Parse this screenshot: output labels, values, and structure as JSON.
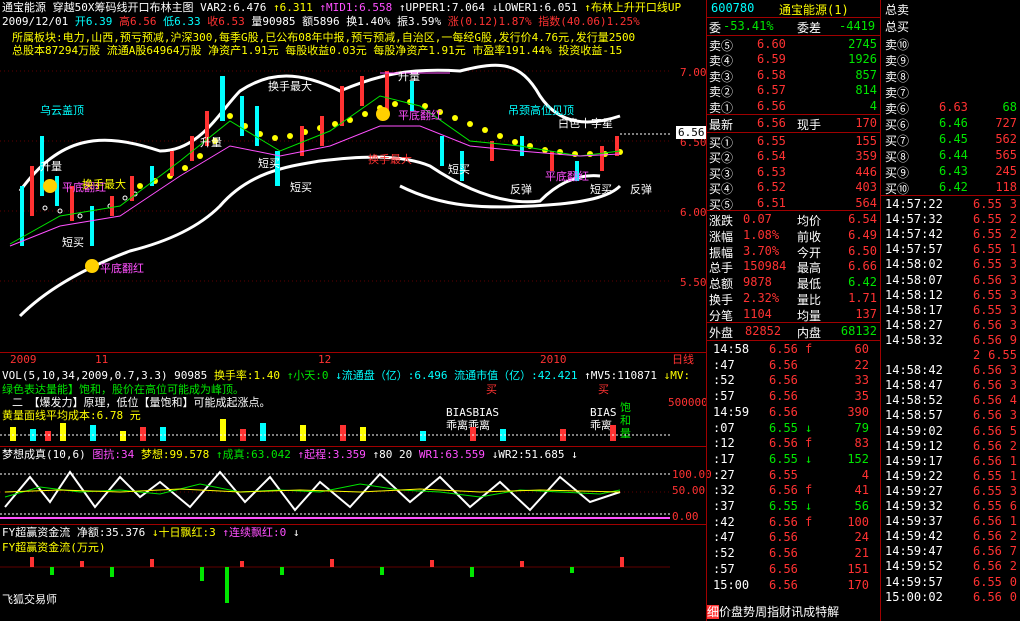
{
  "chart_header": {
    "stock": "通宝能源",
    "indicator": "穿越50X筹码线开口布林主图",
    "var2": "VAR2:6.476",
    "v6": "↑6.311",
    "mid1": "↑MID1:6.558",
    "upper1": "↑UPPER1:7.064",
    "lower1": "↓LOWER1:6.051",
    "boll": "↑布林上升开口线UP",
    "date": "2009/12/01",
    "open": "开6.39",
    "high": "高6.56",
    "low": "低6.33",
    "close": "收6.53",
    "vol": "量90985",
    "amt": "额5896",
    "turn": "换1.40%",
    "amp": "振3.59%",
    "chg": "涨(0.12)1.87%",
    "idx": "指数(40.06)1.25%"
  },
  "info_lines": [
    "所属板块:电力,山西,预亏预减,沪深300,每季G股,已公布08年中报,预亏预减,自治区,一每经G股,发行价4.76元,发行量2500",
    "总股本87294万股   流通A股64964万股   净资产1.91元    每股收益0.03元  每股净资产1.91元    市盈率191.44%   投资收益-15"
  ],
  "price_axis": [
    "7.00",
    "6.50",
    "6.00",
    "5.50"
  ],
  "current_price_tag": "6.56",
  "chart_labels": {
    "wuyun": "乌云盖顶",
    "diaojing": "吊颈高位见顶",
    "huanshou": "换手最大",
    "huanshou2": "换手最大",
    "shengliang": "升量",
    "shengliang2": "升量",
    "shengliang3": "升量",
    "duanmai": "短买",
    "duanmai2": "短买",
    "duanmai3": "短买",
    "duanmai4": "短买",
    "duanmai5": "短买",
    "fantan": "反弹",
    "fantan2": "反弹",
    "baise": "白色十字星",
    "pingdi": "平底翻红",
    "pingdi2": "平底翻红",
    "pingdi3": "平底翻红",
    "pingdi4": "平底翻红",
    "huanshou3": "换手最大"
  },
  "time_axis": {
    "a": "2009",
    "b": "11",
    "c": "12",
    "d": "2010",
    "right": "日线"
  },
  "vol_header": {
    "line1_a": "VOL(5,10,34,2009,0.7,3.3) 90985",
    "line1_b": "换手率:1.40",
    "line1_c": "↑小天:0",
    "line1_d": "↓流通盘（亿）:6.496",
    "line1_e": "流通市值（亿）:42.421",
    "line1_f": "↑MV5:110871",
    "line1_g": "↓MV:",
    "line2": "绿色表达量能】饱和，股价在高位可能成为峰顶。",
    "line3": "二　【爆发力】原理，低位【量饱和】可能成起涨点。",
    "line4": "黄量面线平均成本:6.78 元",
    "max": "500000",
    "bias1": "BIASBIAS",
    "bias2": "乖离乖离",
    "bias3": "BIAS",
    "bias4": "乖离",
    "buy1": "买",
    "buy2": "买",
    "hb": "饱和量"
  },
  "dream_header": {
    "a": "梦想成真(10,6)",
    "b": "图抗:34",
    "c": "梦想:99.578",
    "d": "↑成真:63.042",
    "e": "↑起程:3.359",
    "f": "↑80",
    "g": "20",
    "h": "WR1:63.559",
    "i": "↓WR2:51.685",
    "j": "↓",
    "axis": [
      "100.00",
      "50.00",
      "0.00"
    ]
  },
  "fund_header": {
    "a": "FY超赢资金流",
    "b": "净额:35.376",
    "c": "↓十日飘红:3",
    "d": "↑连续飘红:0",
    "e": "↓",
    "sub": "FY超赢资金流(万元)",
    "footer": "飞狐交易师"
  },
  "quote": {
    "code": "600780",
    "name": "通宝能源(1)",
    "weibi_label": "委",
    "weibi_val": "-53.41%",
    "weicha_label": "委差",
    "weicha_val": "-4419",
    "asks": [
      {
        "label": "卖⑤",
        "price": "6.60",
        "vol": "2745"
      },
      {
        "label": "卖④",
        "price": "6.59",
        "vol": "1926"
      },
      {
        "label": "卖③",
        "price": "6.58",
        "vol": "857"
      },
      {
        "label": "卖②",
        "price": "6.57",
        "vol": "814"
      },
      {
        "label": "卖①",
        "price": "6.56",
        "vol": "4"
      }
    ],
    "last_label": "最新",
    "last_price": "6.56",
    "xianshou_label": "现手",
    "xianshou_val": "170",
    "bids": [
      {
        "label": "买①",
        "price": "6.55",
        "vol": "155"
      },
      {
        "label": "买②",
        "price": "6.54",
        "vol": "359"
      },
      {
        "label": "买③",
        "price": "6.53",
        "vol": "446"
      },
      {
        "label": "买④",
        "price": "6.52",
        "vol": "403"
      },
      {
        "label": "买⑤",
        "price": "6.51",
        "vol": "564"
      }
    ],
    "stats": [
      {
        "l1": "涨跌",
        "v1": "0.07",
        "l2": "均价",
        "v2": "6.54"
      },
      {
        "l1": "涨幅",
        "v1": "1.08%",
        "l2": "前收",
        "v2": "6.49"
      },
      {
        "l1": "振幅",
        "v1": "3.70%",
        "l2": "今开",
        "v2": "6.50"
      },
      {
        "l1": "总手",
        "v1": "150984",
        "l2": "最高",
        "v2": "6.66"
      },
      {
        "l1": "总额",
        "v1": "9878",
        "l2": "最低",
        "v2": "6.42"
      },
      {
        "l1": "换手",
        "v1": "2.32%",
        "l2": "量比",
        "v2": "1.71"
      },
      {
        "l1": "分笔",
        "v1": "1104",
        "l2": "均量",
        "v2": "137"
      }
    ],
    "waipan_label": "外盘",
    "waipan_val": "82852",
    "neipan_label": "内盘",
    "neipan_val": "68132",
    "ticks": [
      {
        "t": "14:58",
        "p": "6.56",
        "d": "f",
        "v": "60"
      },
      {
        "t": ":47",
        "p": "6.56",
        "d": "",
        "v": "22"
      },
      {
        "t": ":52",
        "p": "6.56",
        "d": "",
        "v": "33"
      },
      {
        "t": ":57",
        "p": "6.56",
        "d": "",
        "v": "35"
      },
      {
        "t": "14:59",
        "p": "6.56",
        "d": "",
        "v": "390"
      },
      {
        "t": ":07",
        "p": "6.55",
        "d": "↓",
        "v": "79"
      },
      {
        "t": ":12",
        "p": "6.56",
        "d": "f",
        "v": "83"
      },
      {
        "t": ":17",
        "p": "6.55",
        "d": "↓",
        "v": "152"
      },
      {
        "t": ":27",
        "p": "6.55",
        "d": "",
        "v": "4"
      },
      {
        "t": ":32",
        "p": "6.56",
        "d": "f",
        "v": "41"
      },
      {
        "t": ":37",
        "p": "6.55",
        "d": "↓",
        "v": "56"
      },
      {
        "t": ":42",
        "p": "6.56",
        "d": "f",
        "v": "100"
      },
      {
        "t": ":47",
        "p": "6.56",
        "d": "",
        "v": "24"
      },
      {
        "t": ":52",
        "p": "6.56",
        "d": "",
        "v": "21"
      },
      {
        "t": ":57",
        "p": "6.56",
        "d": "",
        "v": "151"
      },
      {
        "t": "15:00",
        "p": "6.56",
        "d": "",
        "v": "170"
      }
    ],
    "bottom_tabs": [
      "细",
      "价",
      "盘",
      "势",
      "周",
      "指",
      "财",
      "讯",
      "成",
      "特",
      "解"
    ]
  },
  "far_right": {
    "zongmai": "总卖",
    "zongmai2": "总买",
    "sells": [
      "卖⑩",
      "卖⑨",
      "卖⑧",
      "卖⑦",
      "卖⑥"
    ],
    "buys": [
      {
        "l": "买⑥",
        "p": "6.46",
        "v": "727"
      },
      {
        "l": "买⑦",
        "p": "6.45",
        "v": "562"
      },
      {
        "l": "买⑧",
        "p": "6.44",
        "v": "565"
      },
      {
        "l": "买⑨",
        "p": "6.43",
        "v": "245"
      },
      {
        "l": "买⑩",
        "p": "6.42",
        "v": "118"
      }
    ],
    "sell6": {
      "p": "6.63",
      "v": "68"
    },
    "ticks": [
      {
        "t": "14:57:22",
        "p": "6.55",
        "v": "3"
      },
      {
        "t": "14:57:32",
        "p": "6.55",
        "v": "2"
      },
      {
        "t": "14:57:42",
        "p": "6.55",
        "v": "2"
      },
      {
        "t": "14:57:57",
        "p": "6.55",
        "v": "1"
      },
      {
        "t": "14:58:02",
        "p": "6.55",
        "v": "3"
      },
      {
        "t": "14:58:07",
        "p": "6.56",
        "v": "3"
      },
      {
        "t": "14:58:12",
        "p": "6.55",
        "v": "3"
      },
      {
        "t": "14:58:17",
        "p": "6.55",
        "v": "3"
      },
      {
        "t": "14:58:27",
        "p": "6.56",
        "v": "3"
      },
      {
        "t": "14:58:32",
        "p": "6.56",
        "v": "9"
      },
      {
        "t": "",
        "p": "2",
        "v": "6.55"
      },
      {
        "t": "14:58:42",
        "p": "6.56",
        "v": "3"
      },
      {
        "t": "14:58:47",
        "p": "6.56",
        "v": "3"
      },
      {
        "t": "14:58:52",
        "p": "6.56",
        "v": "4"
      },
      {
        "t": "14:58:57",
        "p": "6.56",
        "v": "3"
      },
      {
        "t": "14:59:02",
        "p": "6.56",
        "v": "5"
      },
      {
        "t": "14:59:12",
        "p": "6.56",
        "v": "2"
      },
      {
        "t": "14:59:17",
        "p": "6.56",
        "v": "1"
      },
      {
        "t": "14:59:22",
        "p": "6.55",
        "v": "1"
      },
      {
        "t": "14:59:27",
        "p": "6.55",
        "v": "3"
      },
      {
        "t": "14:59:32",
        "p": "6.55",
        "v": "6"
      },
      {
        "t": "14:59:37",
        "p": "6.56",
        "v": "1"
      },
      {
        "t": "14:59:42",
        "p": "6.56",
        "v": "2"
      },
      {
        "t": "14:59:47",
        "p": "6.56",
        "v": "7"
      },
      {
        "t": "14:59:52",
        "p": "6.56",
        "v": "2"
      },
      {
        "t": "14:59:57",
        "p": "6.55",
        "v": "0"
      },
      {
        "t": "15:00:02",
        "p": "6.56",
        "v": "0"
      }
    ]
  }
}
